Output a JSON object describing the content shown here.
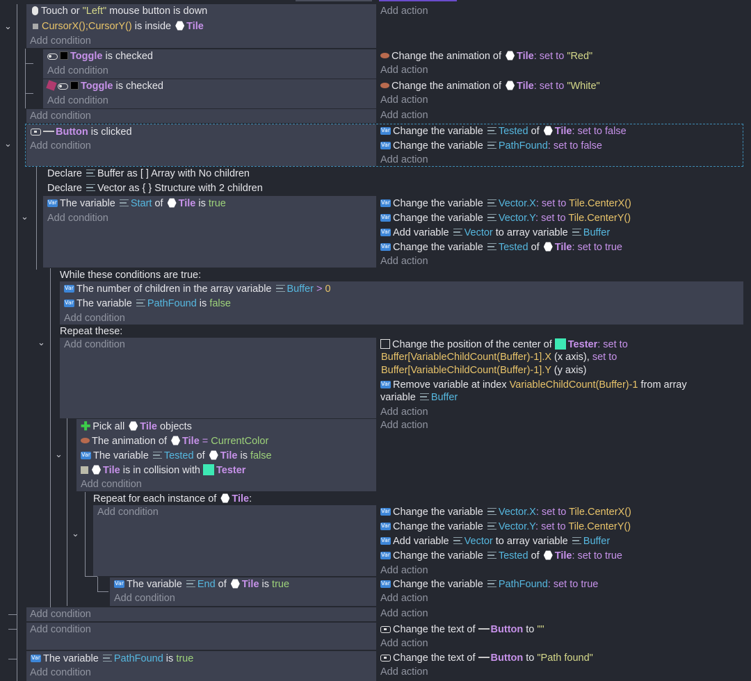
{
  "labels": {
    "add_condition": "Add condition",
    "add_action": "Add action"
  },
  "e1": {
    "c1_pre": "Touch or ",
    "c1_str": "\"Left\"",
    "c1_post": " mouse button is down",
    "c2_expr": "CursorX();CursorY()",
    "c2_mid": " is inside ",
    "c2_obj": "Tile"
  },
  "e2": {
    "obj": "Toggle",
    "cond_text": " is checked",
    "act_pre": "Change the animation of ",
    "act_obj": "Tile",
    "act_set": ": set to ",
    "act_val": "\"Red\""
  },
  "e3": {
    "obj": "Toggle",
    "cond_text": " is checked",
    "act_pre": "Change the animation of ",
    "act_obj": "Tile",
    "act_set": ": set to ",
    "act_val": "\"White\""
  },
  "e4": {
    "obj": "Button",
    "cond_text": " is clicked",
    "a1_pre": "Change the variable ",
    "a1_var": "Tested",
    "a1_of": " of ",
    "a1_obj": "Tile",
    "a1_set": ": set to ",
    "a1_val": "false",
    "a2_pre": "Change the variable ",
    "a2_var": "PathFound",
    "a2_set": ": set to ",
    "a2_val": "false"
  },
  "decl": {
    "d1_kw": "Declare ",
    "d1_name": "Buffer",
    "d1_as": " as ",
    "d1_type": "[ ]",
    "d1_desc": " Array with No children",
    "d2_kw": "Declare ",
    "d2_name": "Vector",
    "d2_as": " as ",
    "d2_type": "{ }",
    "d2_desc": " Structure with 2 children"
  },
  "e5": {
    "c_pre": "The variable ",
    "c_var": "Start",
    "c_of": " of ",
    "c_obj": "Tile",
    "c_is": " is ",
    "c_val": "true",
    "a1_pre": "Change the variable ",
    "a1_var": "Vector.X",
    "a1_set": ": set to ",
    "a1_val": "Tile.CenterX()",
    "a2_pre": "Change the variable ",
    "a2_var": "Vector.Y",
    "a2_set": ": set to ",
    "a2_val": "Tile.CenterY()",
    "a3_pre": "Add variable ",
    "a3_var": "Vector",
    "a3_mid": " to array variable ",
    "a3_var2": "Buffer",
    "a4_pre": "Change the variable ",
    "a4_var": "Tested",
    "a4_of": " of ",
    "a4_obj": "Tile",
    "a4_set": ": set to ",
    "a4_val": "true"
  },
  "wh": {
    "title": "While these conditions are true:",
    "c1_pre": "The number of children in the array variable ",
    "c1_var": "Buffer",
    "c1_op": " > ",
    "c1_val": "0",
    "c2_pre": "The variable ",
    "c2_var": "PathFound",
    "c2_is": " is ",
    "c2_val": "false",
    "repeat": "Repeat these:"
  },
  "rp": {
    "a1_pre": "Change the position of the center of ",
    "a1_obj": "Tester",
    "a1_set": ": set to",
    "a1_l2": "Buffer[VariableChildCount(Buffer)-1].X",
    "a1_l2b": " (x axis), ",
    "a1_l2c": "set to",
    "a1_l3": "Buffer[VariableChildCount(Buffer)-1].Y",
    "a1_l3b": " (y axis)",
    "a2_pre": "Remove variable at index ",
    "a2_expr": "VariableChildCount(Buffer)-1",
    "a2_post": " from array",
    "a2_l2": "variable ",
    "a2_var": "Buffer"
  },
  "pk": {
    "c1_pre": "Pick all ",
    "c1_obj": "Tile",
    "c1_post": " objects",
    "c2_pre": "The animation of ",
    "c2_obj": "Tile",
    "c2_op": " = ",
    "c2_val": "CurrentColor",
    "c3_pre": "The variable ",
    "c3_var": "Tested",
    "c3_of": " of ",
    "c3_obj": "Tile",
    "c3_is": " is ",
    "c3_val": "false",
    "c4_obj": "Tile",
    "c4_mid": " is in collision with ",
    "c4_obj2": "Tester"
  },
  "fe": {
    "title_pre": "Repeat for each instance of ",
    "title_obj": "Tile",
    "title_post": ":",
    "a1_pre": "Change the variable ",
    "a1_var": "Vector.X",
    "a1_set": ": set to ",
    "a1_val": "Tile.CenterX()",
    "a2_pre": "Change the variable ",
    "a2_var": "Vector.Y",
    "a2_set": ": set to ",
    "a2_val": "Tile.CenterY()",
    "a3_pre": "Add variable ",
    "a3_var": "Vector",
    "a3_mid": " to array variable ",
    "a3_var2": "Buffer",
    "a4_pre": "Change the variable ",
    "a4_var": "Tested",
    "a4_of": " of ",
    "a4_obj": "Tile",
    "a4_set": ": set to ",
    "a4_val": "true"
  },
  "en": {
    "c_pre": "The variable ",
    "c_var": "End",
    "c_of": " of ",
    "c_obj": "Tile",
    "c_is": " is ",
    "c_val": "true",
    "a_pre": "Change the variable ",
    "a_var": "PathFound",
    "a_set": ": set to ",
    "a_val": "true"
  },
  "tx": {
    "a_pre": "Change the text of ",
    "a_obj": "Button",
    "a_to": " to ",
    "a_val": "\"\""
  },
  "pf": {
    "c_pre": "The variable ",
    "c_var": "PathFound",
    "c_is": " is ",
    "c_val": "true",
    "a_pre": "Change the text of ",
    "a_obj": "Button",
    "a_to": " to ",
    "a_val": "\"Path found\""
  }
}
